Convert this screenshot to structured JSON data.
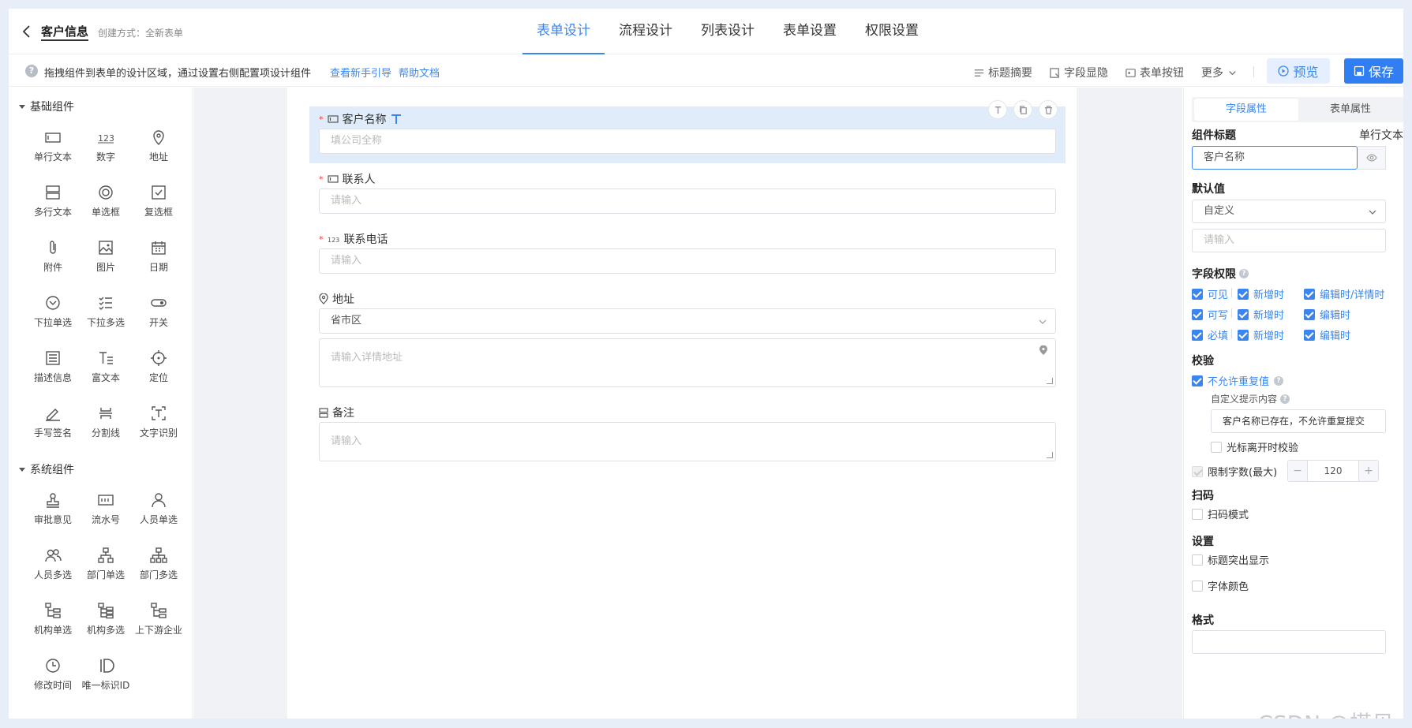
{
  "header": {
    "title": "客户信息",
    "create_mode": "创建方式：全新表单",
    "tabs": [
      "表单设计",
      "流程设计",
      "列表设计",
      "表单设置",
      "权限设置"
    ]
  },
  "toolbar": {
    "hint": "拖拽组件到表单的设计区域，通过设置右侧配置项设计组件",
    "guide_link": "查看新手引导",
    "help_link": "帮助文档",
    "title_summary": "标题摘要",
    "field_visibility": "字段显隐",
    "form_buttons": "表单按钮",
    "more": "更多",
    "preview": "预览",
    "save": "保存"
  },
  "left_panel": {
    "basic_group": "基础组件",
    "basic_items": [
      "单行文本",
      "数字",
      "地址",
      "多行文本",
      "单选框",
      "复选框",
      "附件",
      "图片",
      "日期",
      "下拉单选",
      "下拉多选",
      "开关",
      "描述信息",
      "富文本",
      "定位",
      "手写签名",
      "分割线",
      "文字识别"
    ],
    "system_group": "系统组件",
    "system_items": [
      "审批意见",
      "流水号",
      "人员单选",
      "人员多选",
      "部门单选",
      "部门多选",
      "机构单选",
      "机构多选",
      "上下游企业",
      "修改时间",
      "唯一标识ID"
    ]
  },
  "form": {
    "customer_name": {
      "label": "客户名称",
      "placeholder": "填公司全称"
    },
    "contact": {
      "label": "联系人",
      "placeholder": "请输入"
    },
    "phone": {
      "label": "联系电话",
      "placeholder": "请输入"
    },
    "address": {
      "label": "地址",
      "region": "省市区",
      "detail_placeholder": "请输入详情地址"
    },
    "remark": {
      "label": "备注",
      "placeholder": "请输入"
    }
  },
  "right_panel": {
    "tabs": [
      "字段属性",
      "表单属性"
    ],
    "component_title_label": "组件标题",
    "component_type": "单行文本",
    "component_title_value": "客户名称",
    "default_value_label": "默认值",
    "default_value_mode": "自定义",
    "default_value_placeholder": "请输入",
    "field_perm_label": "字段权限",
    "perm_rows": [
      [
        "可见",
        "新增时",
        "编辑时/详情时"
      ],
      [
        "可写",
        "新增时",
        "编辑时"
      ],
      [
        "必填",
        "新增时",
        "编辑时"
      ]
    ],
    "validate_label": "校验",
    "no_duplicate": "不允许重复值",
    "custom_tip_label": "自定义提示内容",
    "custom_tip_value": "客户名称已存在，不允许重复提交",
    "blur_validate": "光标离开时校验",
    "limit_chars": "限制字数(最大)",
    "limit_value": "120",
    "scan_label": "扫码",
    "scan_mode": "扫码模式",
    "settings_label": "设置",
    "title_highlight": "标题突出显示",
    "font_color": "字体颜色",
    "format_label": "格式"
  },
  "watermark": "CSDN @搭贝",
  "colors": {
    "accent": "#3a86f0",
    "selected_field": "#e1ecfb",
    "required": "#f23c3c"
  }
}
